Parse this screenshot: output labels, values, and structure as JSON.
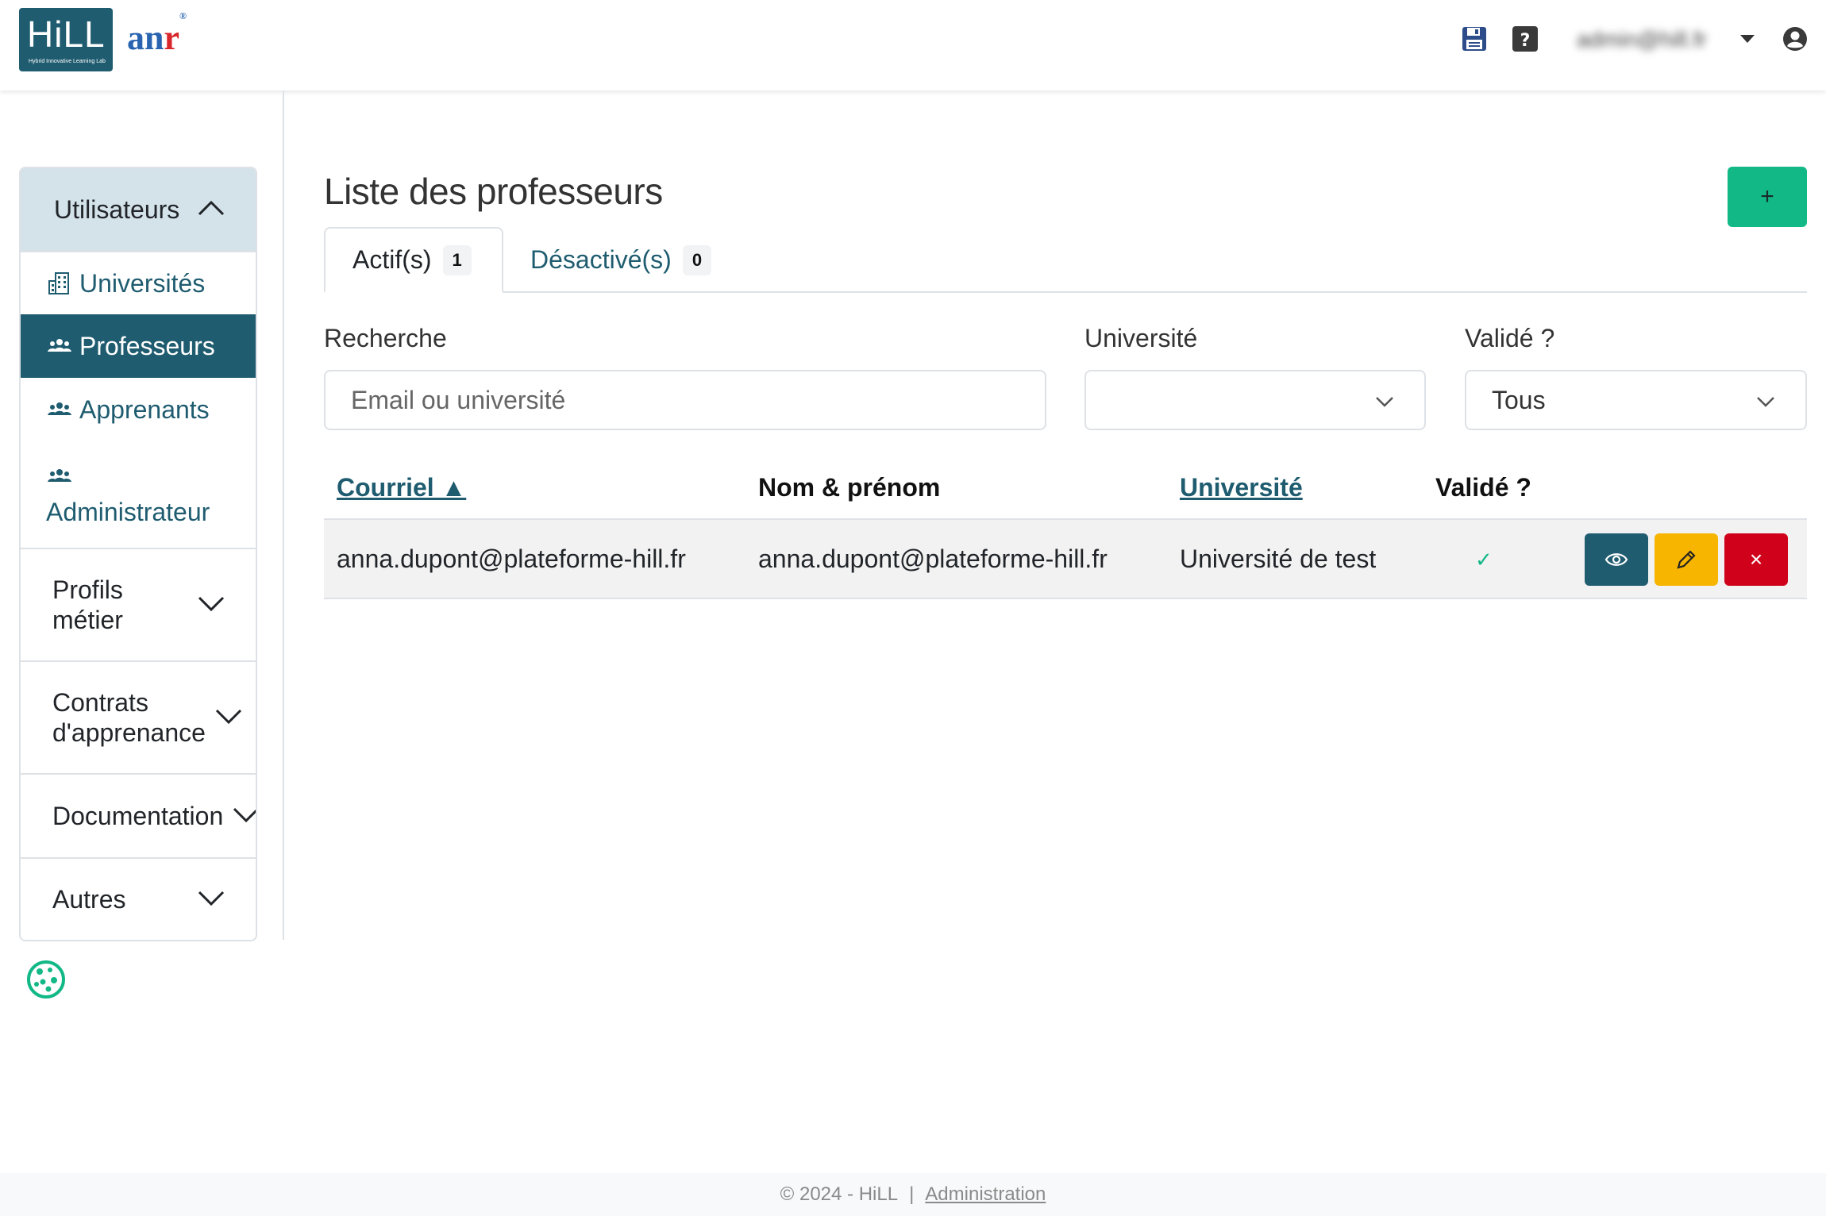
{
  "header": {
    "logo_hill_text": "HiLL",
    "logo_hill_subtitle": "Hybrid Innovative Learning Lab",
    "logo_anr_a": "an",
    "logo_anr_r": "r",
    "logo_anr_mark": "®",
    "user_email": "admin@hill.fr",
    "icons": [
      "save-icon",
      "help-icon",
      "user-menu-caret-icon",
      "account-icon"
    ]
  },
  "sidebar": {
    "section_title": "Utilisateurs",
    "links": [
      {
        "label": "Universités",
        "icon": "building-icon",
        "active": false
      },
      {
        "label": "Professeurs",
        "icon": "users-icon",
        "active": true
      },
      {
        "label": "Apprenants",
        "icon": "users-icon",
        "active": false
      },
      {
        "label": "Administrateur",
        "icon": "users-icon",
        "active": false
      }
    ],
    "accordions": [
      {
        "label_line1": "Profils",
        "label_line2": "métier"
      },
      {
        "label_line1": "Contrats",
        "label_line2": "d'apprenance"
      },
      {
        "label_line1": "Documentation",
        "label_line2": ""
      },
      {
        "label_line1": "Autres",
        "label_line2": ""
      }
    ]
  },
  "main": {
    "title": "Liste des professeurs",
    "add_button_label": "+",
    "tabs": [
      {
        "label": "Actif(s)",
        "count": "1",
        "active": true
      },
      {
        "label": "Désactivé(s)",
        "count": "0",
        "active": false
      }
    ],
    "filters": {
      "search_label": "Recherche",
      "search_placeholder": "Email ou université",
      "university_label": "Université",
      "university_value": "",
      "validated_label": "Validé ?",
      "validated_value": "Tous"
    },
    "table": {
      "columns": [
        "Courriel ▲",
        "Nom & prénom",
        "Université",
        "Validé ?"
      ],
      "rows": [
        {
          "email": "anna.dupont@plateforme-hill.fr",
          "name": "anna.dupont@plateforme-hill.fr",
          "university": "Université de test",
          "validated": "✓"
        }
      ],
      "actions": {
        "view": "view-icon",
        "edit": "pencil-icon",
        "delete": "×"
      }
    }
  },
  "footer": {
    "copyright": "© 2024 - HiLL",
    "separator": "|",
    "link": "Administration"
  },
  "colors": {
    "primary": "#1f5c70",
    "success": "#12b886",
    "warning": "#f7b500",
    "danger": "#d0021b",
    "sidebar_header_bg": "#d4e2e9"
  }
}
